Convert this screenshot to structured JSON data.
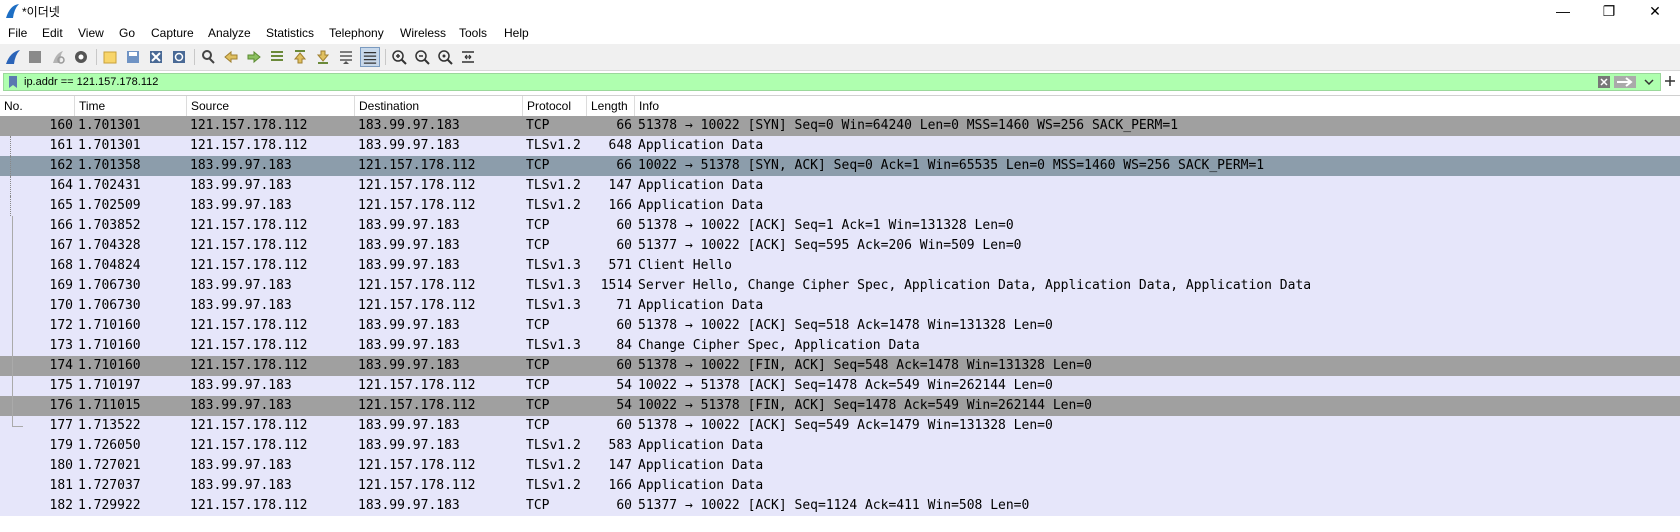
{
  "window": {
    "title": "*이더넷",
    "minimize_glyph": "—",
    "maximize_glyph": "❐",
    "close_glyph": "✕"
  },
  "menu": [
    "File",
    "Edit",
    "View",
    "Go",
    "Capture",
    "Analyze",
    "Statistics",
    "Telephony",
    "Wireless",
    "Tools",
    "Help"
  ],
  "toolbar": {
    "icons": [
      "shark-fin-start-icon",
      "stop-icon",
      "restart-icon",
      "capture-options-icon",
      "open-file-icon",
      "save-file-icon",
      "close-file-icon",
      "reload-icon",
      "find-packet-icon",
      "go-back-icon",
      "go-forward-icon",
      "go-to-packet-icon",
      "go-first-icon",
      "go-last-icon",
      "autoscroll-icon",
      "colorize-icon",
      "zoom-in-icon",
      "zoom-out-icon",
      "normal-size-icon",
      "resize-columns-icon"
    ]
  },
  "filter": {
    "value": "ip.addr == 121.157.178.112",
    "bg_color": "#afffaf"
  },
  "columns": {
    "no": "No.",
    "time": "Time",
    "source": "Source",
    "destination": "Destination",
    "protocol": "Protocol",
    "length": "Length",
    "info": "Info"
  },
  "colors": {
    "row_default": "#e6e6fa",
    "row_dark": "#a0a0a0",
    "row_selected": "#8c9dab"
  },
  "packets": [
    {
      "no": "160",
      "time": "1.701301",
      "src": "121.157.178.112",
      "dst": "183.99.97.183",
      "proto": "TCP",
      "len": "66",
      "info": "51378 → 10022 [SYN] Seq=0 Win=64240 Len=0 MSS=1460 WS=256 SACK_PERM=1",
      "style": "dark"
    },
    {
      "no": "161",
      "time": "1.701301",
      "src": "121.157.178.112",
      "dst": "183.99.97.183",
      "proto": "TLSv1.2",
      "len": "648",
      "info": "Application Data",
      "style": "normal"
    },
    {
      "no": "162",
      "time": "1.701358",
      "src": "183.99.97.183",
      "dst": "121.157.178.112",
      "proto": "TCP",
      "len": "66",
      "info": "10022 → 51378 [SYN, ACK] Seq=0 Ack=1 Win=65535 Len=0 MSS=1460 WS=256 SACK_PERM=1",
      "style": "sel"
    },
    {
      "no": "164",
      "time": "1.702431",
      "src": "183.99.97.183",
      "dst": "121.157.178.112",
      "proto": "TLSv1.2",
      "len": "147",
      "info": "Application Data",
      "style": "normal"
    },
    {
      "no": "165",
      "time": "1.702509",
      "src": "183.99.97.183",
      "dst": "121.157.178.112",
      "proto": "TLSv1.2",
      "len": "166",
      "info": "Application Data",
      "style": "normal"
    },
    {
      "no": "166",
      "time": "1.703852",
      "src": "121.157.178.112",
      "dst": "183.99.97.183",
      "proto": "TCP",
      "len": "60",
      "info": "51378 → 10022 [ACK] Seq=1 Ack=1 Win=131328 Len=0",
      "style": "normal"
    },
    {
      "no": "167",
      "time": "1.704328",
      "src": "121.157.178.112",
      "dst": "183.99.97.183",
      "proto": "TCP",
      "len": "60",
      "info": "51377 → 10022 [ACK] Seq=595 Ack=206 Win=509 Len=0",
      "style": "normal"
    },
    {
      "no": "168",
      "time": "1.704824",
      "src": "121.157.178.112",
      "dst": "183.99.97.183",
      "proto": "TLSv1.3",
      "len": "571",
      "info": "Client Hello",
      "style": "normal"
    },
    {
      "no": "169",
      "time": "1.706730",
      "src": "183.99.97.183",
      "dst": "121.157.178.112",
      "proto": "TLSv1.3",
      "len": "1514",
      "info": "Server Hello, Change Cipher Spec, Application Data, Application Data, Application Data",
      "style": "normal"
    },
    {
      "no": "170",
      "time": "1.706730",
      "src": "183.99.97.183",
      "dst": "121.157.178.112",
      "proto": "TLSv1.3",
      "len": "71",
      "info": "Application Data",
      "style": "normal"
    },
    {
      "no": "172",
      "time": "1.710160",
      "src": "121.157.178.112",
      "dst": "183.99.97.183",
      "proto": "TCP",
      "len": "60",
      "info": "51378 → 10022 [ACK] Seq=518 Ack=1478 Win=131328 Len=0",
      "style": "normal"
    },
    {
      "no": "173",
      "time": "1.710160",
      "src": "121.157.178.112",
      "dst": "183.99.97.183",
      "proto": "TLSv1.3",
      "len": "84",
      "info": "Change Cipher Spec, Application Data",
      "style": "normal"
    },
    {
      "no": "174",
      "time": "1.710160",
      "src": "121.157.178.112",
      "dst": "183.99.97.183",
      "proto": "TCP",
      "len": "60",
      "info": "51378 → 10022 [FIN, ACK] Seq=548 Ack=1478 Win=131328 Len=0",
      "style": "dark"
    },
    {
      "no": "175",
      "time": "1.710197",
      "src": "183.99.97.183",
      "dst": "121.157.178.112",
      "proto": "TCP",
      "len": "54",
      "info": "10022 → 51378 [ACK] Seq=1478 Ack=549 Win=262144 Len=0",
      "style": "normal"
    },
    {
      "no": "176",
      "time": "1.711015",
      "src": "183.99.97.183",
      "dst": "121.157.178.112",
      "proto": "TCP",
      "len": "54",
      "info": "10022 → 51378 [FIN, ACK] Seq=1478 Ack=549 Win=262144 Len=0",
      "style": "dark"
    },
    {
      "no": "177",
      "time": "1.713522",
      "src": "121.157.178.112",
      "dst": "183.99.97.183",
      "proto": "TCP",
      "len": "60",
      "info": "51378 → 10022 [ACK] Seq=549 Ack=1479 Win=131328 Len=0",
      "style": "normal"
    },
    {
      "no": "179",
      "time": "1.726050",
      "src": "121.157.178.112",
      "dst": "183.99.97.183",
      "proto": "TLSv1.2",
      "len": "583",
      "info": "Application Data",
      "style": "normal"
    },
    {
      "no": "180",
      "time": "1.727021",
      "src": "183.99.97.183",
      "dst": "121.157.178.112",
      "proto": "TLSv1.2",
      "len": "147",
      "info": "Application Data",
      "style": "normal"
    },
    {
      "no": "181",
      "time": "1.727037",
      "src": "183.99.97.183",
      "dst": "121.157.178.112",
      "proto": "TLSv1.2",
      "len": "166",
      "info": "Application Data",
      "style": "normal"
    },
    {
      "no": "182",
      "time": "1.729922",
      "src": "121.157.178.112",
      "dst": "183.99.97.183",
      "proto": "TCP",
      "len": "60",
      "info": "51377 → 10022 [ACK] Seq=1124 Ack=411 Win=508 Len=0",
      "style": "normal"
    }
  ]
}
